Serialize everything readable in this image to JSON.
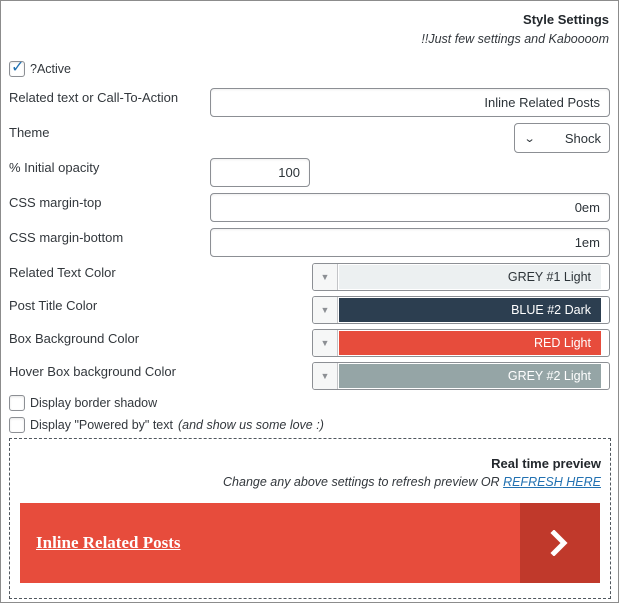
{
  "header": {
    "title": "Style Settings",
    "subtitle": "!!Just few settings and Kaboooom"
  },
  "active": {
    "label": "?Active",
    "checked": true
  },
  "related_text": {
    "label": "Related text or Call-To-Action",
    "value": "Inline Related Posts"
  },
  "theme": {
    "label": "Theme",
    "value": "Shock",
    "icon": "chevron-down-icon"
  },
  "opacity": {
    "label": "% Initial opacity",
    "value": "100"
  },
  "margin_top": {
    "label": "CSS margin-top",
    "value": "0em"
  },
  "margin_bottom": {
    "label": "CSS margin-bottom",
    "value": "1em"
  },
  "colors": [
    {
      "label": "Related Text Color",
      "value": "GREY #1 Light",
      "swatch": "#ecf0f1",
      "text_color": "#2c3338"
    },
    {
      "label": "Post Title Color",
      "value": "BLUE #2 Dark",
      "swatch": "#2c3e50",
      "text_color": "#ffffff"
    },
    {
      "label": "Box Background Color",
      "value": "RED Light",
      "swatch": "#e74c3c",
      "text_color": "#ffffff"
    },
    {
      "label": "Hover Box background Color",
      "value": "GREY #2 Light",
      "swatch": "#95a5a6",
      "text_color": "#ffffff"
    }
  ],
  "border_shadow": {
    "label": "Display border shadow",
    "checked": false
  },
  "powered_by": {
    "label": "Display \"Powered by\" text",
    "note": "(and show us some love :)",
    "checked": false
  },
  "preview": {
    "title": "Real time preview",
    "subtitle": "Change any above settings to refresh preview OR",
    "refresh_link": "REFRESH HERE",
    "banner_text": "Inline Related Posts",
    "banner_bg": "#e74c3c",
    "arrow_bg": "#c0392b",
    "arrow_icon": "chevron-right-icon"
  }
}
